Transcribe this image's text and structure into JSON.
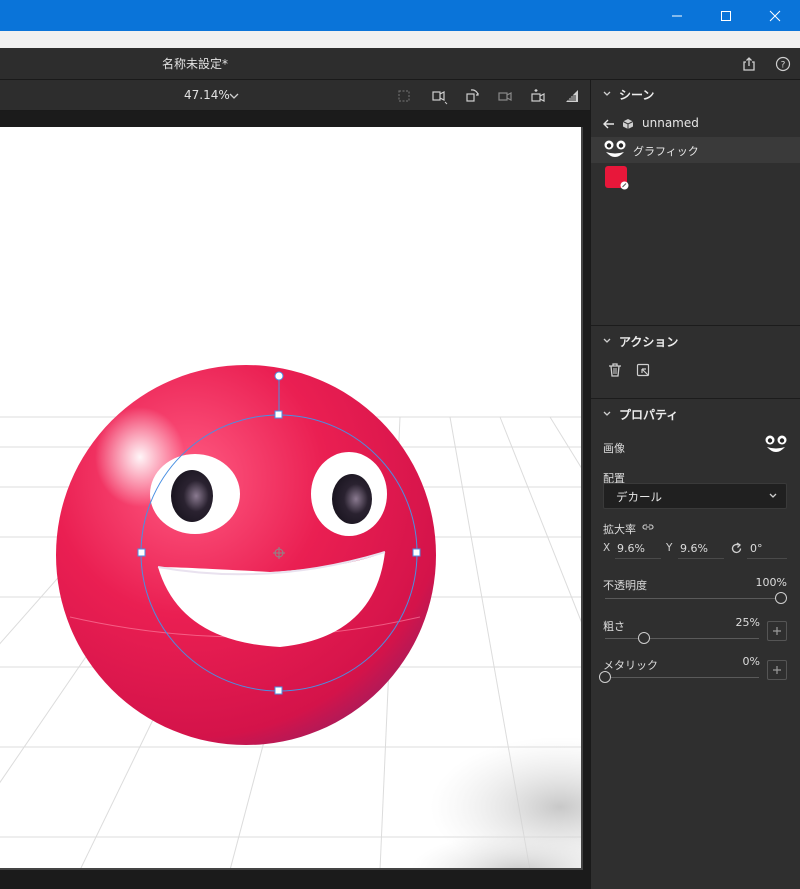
{
  "window": {
    "title": "名称未設定*"
  },
  "toolbar": {
    "zoom": "47.14%"
  },
  "scene": {
    "header": "シーン",
    "root_name": "unnamed",
    "child_name": "グラフィック",
    "swatch_color": "#e8173a"
  },
  "actions": {
    "header": "アクション"
  },
  "properties": {
    "header": "プロパティ",
    "image_label": "画像",
    "placement_label": "配置",
    "placement_value": "デカール",
    "scale_label": "拡大率",
    "x_label": "X",
    "x_value": "9.6%",
    "y_label": "Y",
    "y_value": "9.6%",
    "rotation_value": "0°",
    "opacity_label": "不透明度",
    "opacity_value": "100%",
    "opacity_level": 1.0,
    "roughness_label": "粗さ",
    "roughness_value": "25%",
    "roughness_level": 0.25,
    "metallic_label": "メタリック",
    "metallic_value": "0%",
    "metallic_level": 0.0
  },
  "colors": {
    "window_accent": "#0a74d9",
    "ball": "#e8204f",
    "selection": "#4a90e2"
  }
}
